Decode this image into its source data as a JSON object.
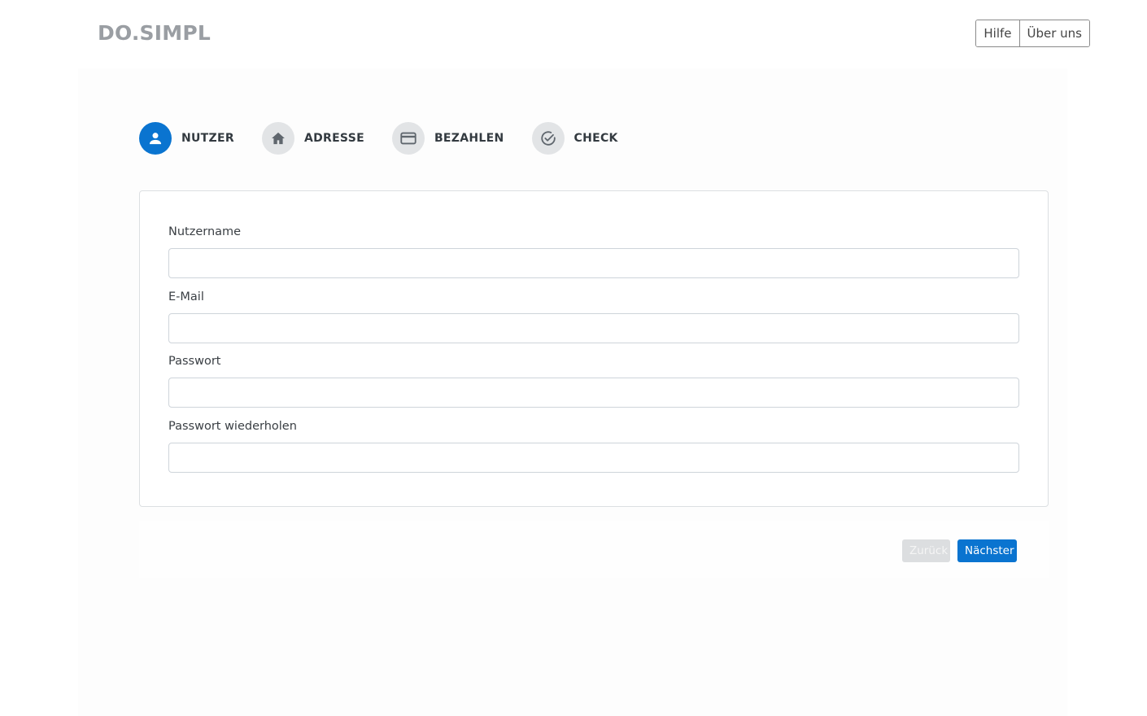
{
  "header": {
    "brand": "DO.SIMPL",
    "nav": [
      {
        "label": "Hilfe"
      },
      {
        "label": "Über uns"
      }
    ]
  },
  "stepper": {
    "steps": [
      {
        "label": "NUTZER",
        "icon": "user-icon",
        "active": true
      },
      {
        "label": "ADRESSE",
        "icon": "home-icon",
        "active": false
      },
      {
        "label": "BEZAHLEN",
        "icon": "credit-card-icon",
        "active": false
      },
      {
        "label": "CHECK",
        "icon": "check-circle-icon",
        "active": false
      }
    ]
  },
  "form": {
    "fields": [
      {
        "label": "Nutzername",
        "value": "",
        "placeholder": ""
      },
      {
        "label": "E-Mail",
        "value": "",
        "placeholder": ""
      },
      {
        "label": "Passwort",
        "value": "",
        "placeholder": ""
      },
      {
        "label": "Passwort wiederholen",
        "value": "",
        "placeholder": ""
      }
    ]
  },
  "actions": {
    "back_label": "Zurück",
    "next_label": "Nächster"
  },
  "colors": {
    "accent": "#0a74d0",
    "brand_text": "#9a9ea3",
    "inactive_step": "#e2e4e6",
    "disabled_button": "#dcdee0"
  }
}
